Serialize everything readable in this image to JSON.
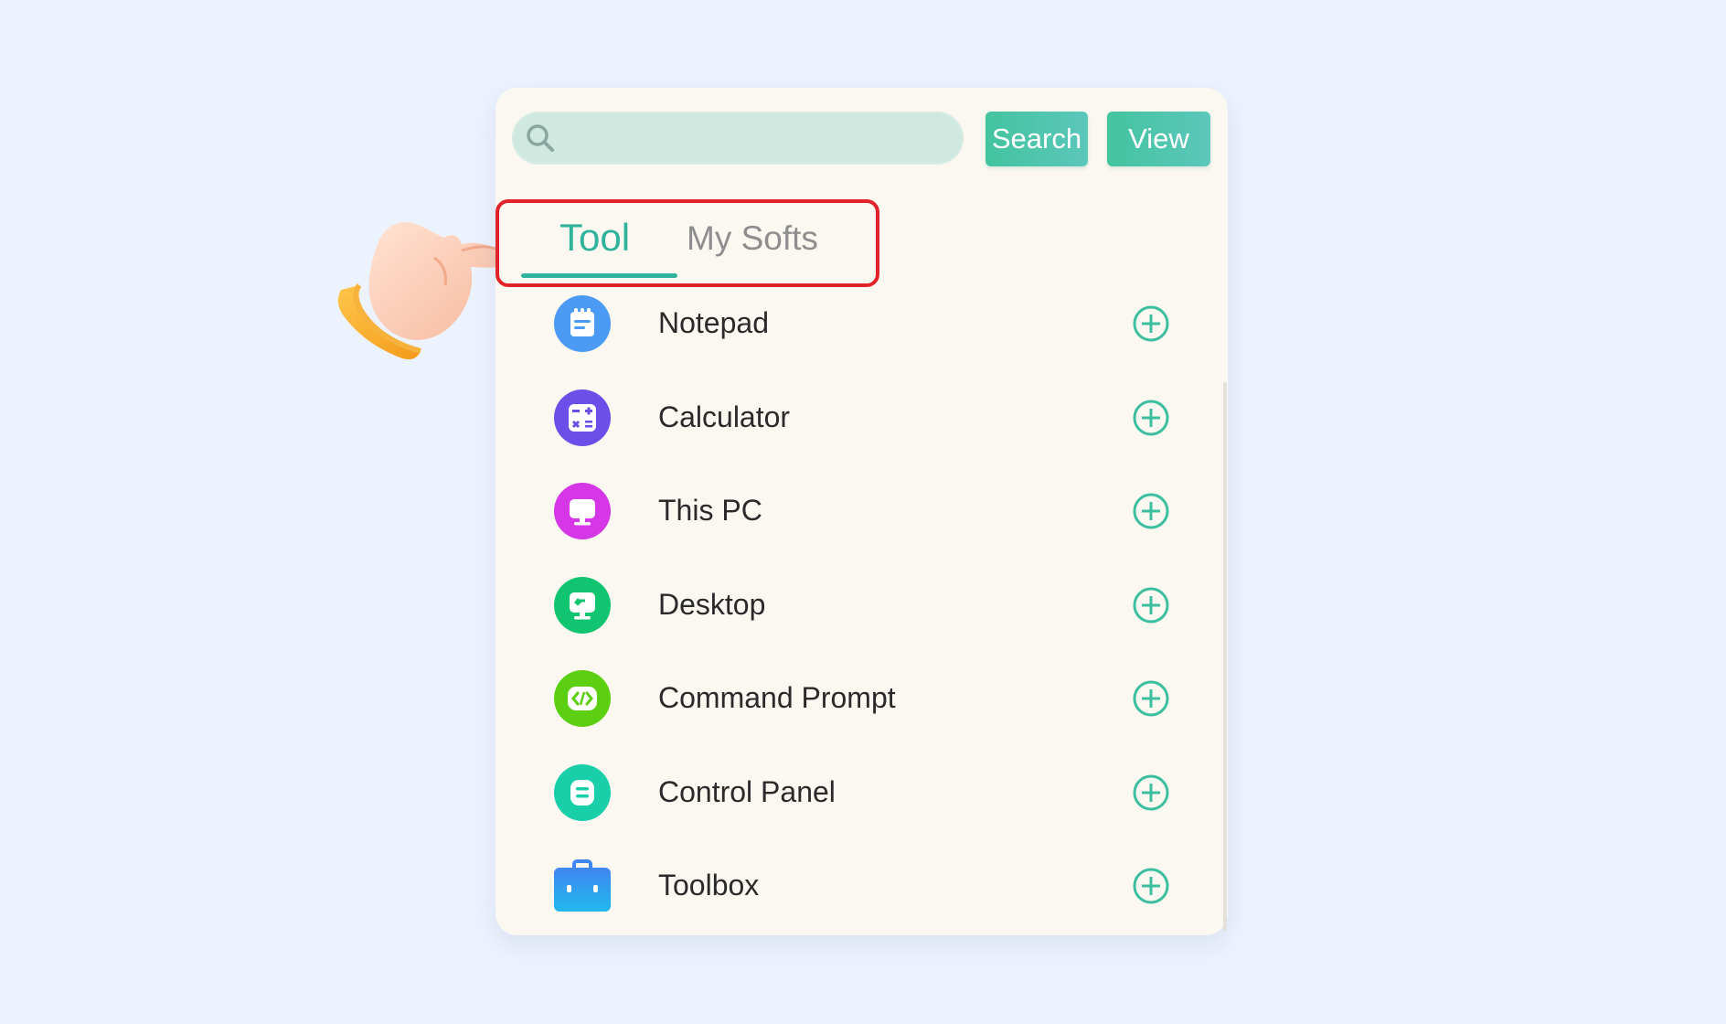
{
  "search": {
    "placeholder": "",
    "value": "",
    "button_label": "Search"
  },
  "view": {
    "button_label": "View"
  },
  "tabs": [
    {
      "label": "Tool",
      "active": true
    },
    {
      "label": "My Softs",
      "active": false
    }
  ],
  "colors": {
    "accent": "#2fb49b",
    "highlight_box": "#e2222a",
    "background": "#edf3fe",
    "panel": "#fbf8f1"
  },
  "items": [
    {
      "label": "Notepad",
      "icon": "notepad-icon",
      "color": "#4b9bf4"
    },
    {
      "label": "Calculator",
      "icon": "calculator-icon",
      "color": "#6c4fe8"
    },
    {
      "label": "This PC",
      "icon": "monitor-icon",
      "color": "#d637e6"
    },
    {
      "label": "Desktop",
      "icon": "desktop-icon",
      "color": "#11c46f"
    },
    {
      "label": "Command Prompt",
      "icon": "code-icon",
      "color": "#5ccf12"
    },
    {
      "label": "Control Panel",
      "icon": "control-panel-icon",
      "color": "#18cfa9"
    },
    {
      "label": "Toolbox",
      "icon": "toolbox-icon",
      "color": "#2e97f2"
    }
  ]
}
